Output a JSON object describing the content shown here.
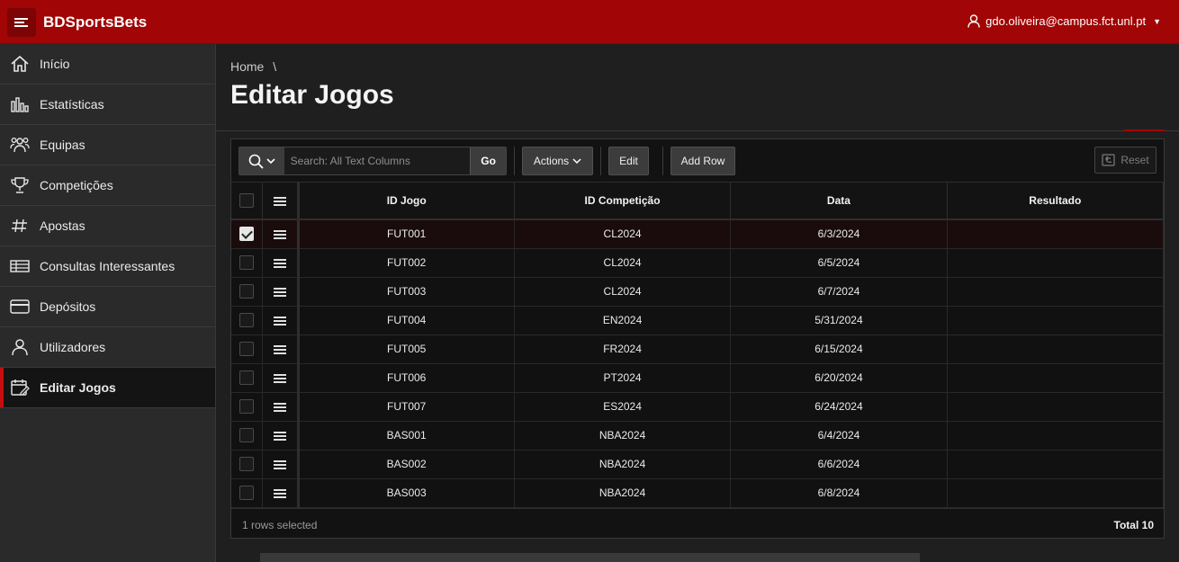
{
  "app": {
    "title": "BDSportsBets",
    "user": "gdo.oliveira@campus.fct.unl.pt"
  },
  "nav": [
    {
      "label": "Início",
      "icon": "home-icon"
    },
    {
      "label": "Estatísticas",
      "icon": "bar-chart-icon"
    },
    {
      "label": "Equipas",
      "icon": "users-icon"
    },
    {
      "label": "Competições",
      "icon": "trophy-icon"
    },
    {
      "label": "Apostas",
      "icon": "hashtag-icon"
    },
    {
      "label": "Consultas Interessantes",
      "icon": "table-icon"
    },
    {
      "label": "Depósitos",
      "icon": "credit-card-icon"
    },
    {
      "label": "Utilizadores",
      "icon": "user-icon"
    },
    {
      "label": "Editar Jogos",
      "icon": "calendar-edit-icon",
      "active": true
    }
  ],
  "breadcrumb": {
    "home": "Home",
    "separator": "\\"
  },
  "page": {
    "title": "Editar Jogos"
  },
  "toolbar": {
    "search_placeholder": "Search: All Text Columns",
    "go": "Go",
    "actions": "Actions",
    "edit": "Edit",
    "add_row": "Add Row",
    "reset": "Reset"
  },
  "table": {
    "columns": [
      "ID Jogo",
      "ID Competição",
      "Data",
      "Resultado"
    ],
    "rows": [
      {
        "id": "FUT001",
        "comp": "CL2024",
        "data": "6/3/2024",
        "resultado": "",
        "selected": true
      },
      {
        "id": "FUT002",
        "comp": "CL2024",
        "data": "6/5/2024",
        "resultado": ""
      },
      {
        "id": "FUT003",
        "comp": "CL2024",
        "data": "6/7/2024",
        "resultado": ""
      },
      {
        "id": "FUT004",
        "comp": "EN2024",
        "data": "5/31/2024",
        "resultado": ""
      },
      {
        "id": "FUT005",
        "comp": "FR2024",
        "data": "6/15/2024",
        "resultado": ""
      },
      {
        "id": "FUT006",
        "comp": "PT2024",
        "data": "6/20/2024",
        "resultado": ""
      },
      {
        "id": "FUT007",
        "comp": "ES2024",
        "data": "6/24/2024",
        "resultado": ""
      },
      {
        "id": "BAS001",
        "comp": "NBA2024",
        "data": "6/4/2024",
        "resultado": ""
      },
      {
        "id": "BAS002",
        "comp": "NBA2024",
        "data": "6/6/2024",
        "resultado": ""
      },
      {
        "id": "BAS003",
        "comp": "NBA2024",
        "data": "6/8/2024",
        "resultado": ""
      }
    ]
  },
  "footer": {
    "rows_selected": "1 rows selected",
    "total": "Total 10"
  },
  "colors": {
    "brand": "#a10505",
    "background": "#201f1f",
    "sidebar": "#2b2a2a"
  }
}
